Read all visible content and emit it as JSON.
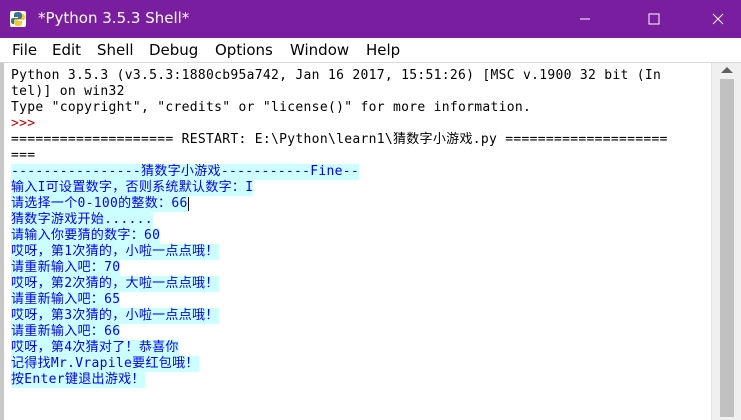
{
  "window": {
    "title": "*Python 3.5.3 Shell*",
    "accent_color": "#7a1ea0"
  },
  "menu": {
    "items": [
      "File",
      "Edit",
      "Shell",
      "Debug",
      "Options",
      "Window",
      "Help"
    ]
  },
  "shell": {
    "lines": [
      {
        "text": "Python 3.5.3 (v3.5.3:1880cb95a742, Jan 16 2017, 15:51:26) [MSC v.1900 32 bit (In",
        "role": "banner"
      },
      {
        "text": "tel)] on win32",
        "role": "banner"
      },
      {
        "text": "Type \"copyright\", \"credits\" or \"license()\" for more information.",
        "role": "banner"
      },
      {
        "text": ">>> ",
        "role": "prompt"
      },
      {
        "text": "==================== RESTART: E:\\Python\\learn1\\猜数字小游戏.py ====================",
        "role": "banner"
      },
      {
        "text": "===",
        "role": "banner"
      },
      {
        "text": "----------------猜数字小游戏-----------Fine--",
        "role": "stdout"
      },
      {
        "text": "输入I可设置数字，否则系统默认数字：I",
        "role": "stdout"
      },
      {
        "text": "请选择一个0-100的整数：66",
        "role": "stdout"
      },
      {
        "text": "猜数字游戏开始......",
        "role": "stdout"
      },
      {
        "text": "请输入你要猜的数字：60",
        "role": "stdout"
      },
      {
        "text": "哎呀，第1次猜的，小啦一点点哦！",
        "role": "stdout"
      },
      {
        "text": "请重新输入吧：70",
        "role": "stdout"
      },
      {
        "text": "哎呀，第2次猜的，大啦一点点哦！",
        "role": "stdout"
      },
      {
        "text": "请重新输入吧：65",
        "role": "stdout"
      },
      {
        "text": "哎呀，第3次猜的，小啦一点点哦！",
        "role": "stdout"
      },
      {
        "text": "请重新输入吧：66",
        "role": "stdout"
      },
      {
        "text": "哎呀，第4次猜对了！恭喜你",
        "role": "stdout"
      },
      {
        "text": "记得找Mr.Vrapile要红包哦！",
        "role": "stdout"
      },
      {
        "text": "按Enter键退出游戏！",
        "role": "stdout"
      }
    ]
  }
}
